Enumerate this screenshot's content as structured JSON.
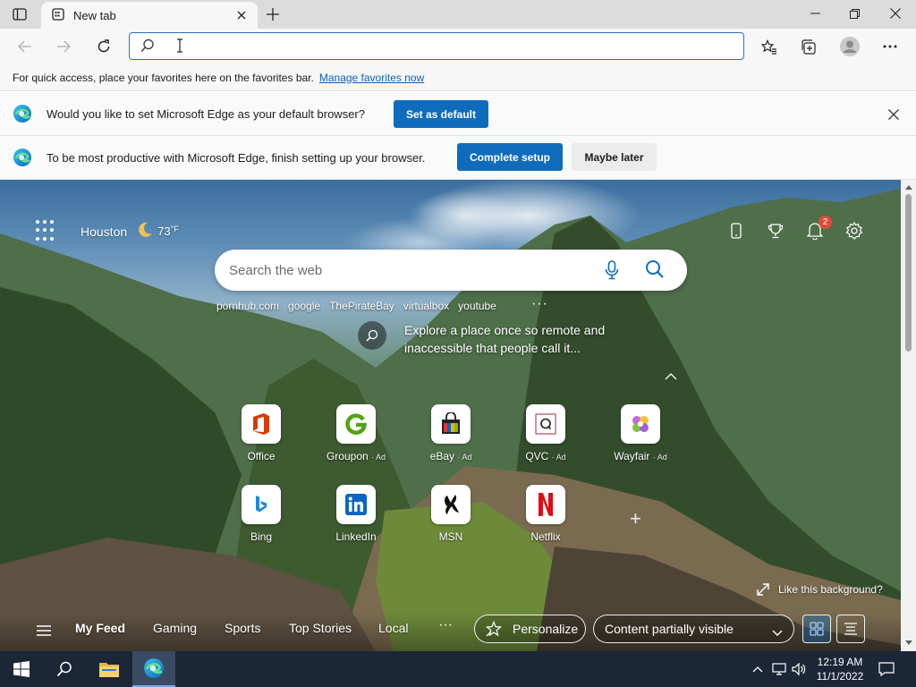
{
  "browser": {
    "tab_title": "New tab",
    "address": {
      "value": "",
      "placeholder": ""
    }
  },
  "favorites_bar": {
    "message": "For quick access, place your favorites here on the favorites bar.",
    "link": "Manage favorites now"
  },
  "infobar_default": {
    "message": "Would you like to set Microsoft Edge as your default browser?",
    "button": "Set as default"
  },
  "infobar_setup": {
    "message": "To be most productive with Microsoft Edge, finish setting up your browser.",
    "primary_button": "Complete setup",
    "secondary_button": "Maybe later"
  },
  "ntp": {
    "weather": {
      "city": "Houston",
      "temp": "73",
      "unit": "°F"
    },
    "notifications_count": "2",
    "search": {
      "placeholder": "Search the web"
    },
    "trending": [
      "pornhub.com",
      "google",
      "ThePirateBay",
      "virtualbox",
      "youtube"
    ],
    "trending_more": "···",
    "explore_text": "Explore a place once so remote and inaccessible that people call it...",
    "tiles": [
      {
        "name": "Office",
        "ad": ""
      },
      {
        "name": "Groupon",
        "ad": "· Ad"
      },
      {
        "name": "eBay",
        "ad": "· Ad"
      },
      {
        "name": "QVC",
        "ad": "· Ad"
      },
      {
        "name": "Wayfair",
        "ad": "· Ad"
      },
      {
        "name": "Bing",
        "ad": ""
      },
      {
        "name": "LinkedIn",
        "ad": ""
      },
      {
        "name": "MSN",
        "ad": ""
      },
      {
        "name": "Netflix",
        "ad": ""
      }
    ],
    "add_tile": "+",
    "like_background": "Like this background?",
    "feed": {
      "tabs": [
        "My Feed",
        "Gaming",
        "Sports",
        "Top Stories",
        "Local"
      ],
      "more": "···",
      "personalize": "Personalize",
      "visibility": "Content partially visible"
    }
  },
  "taskbar": {
    "time": "12:19 AM",
    "date": "11/1/2022"
  },
  "colors": {
    "accent": "#0f6cbd",
    "address_border": "#2f6fcf",
    "taskbar": "#1b2636",
    "badge": "#e14b36"
  }
}
